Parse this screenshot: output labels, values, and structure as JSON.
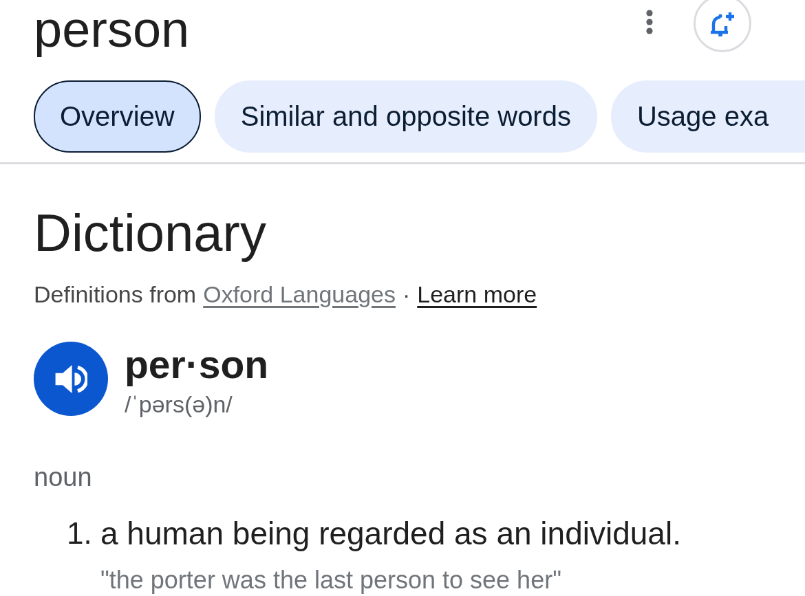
{
  "header": {
    "title": "person"
  },
  "tabs": [
    {
      "label": "Overview",
      "selected": true
    },
    {
      "label": "Similar and opposite words",
      "selected": false
    },
    {
      "label": "Usage exa",
      "selected": false
    }
  ],
  "dictionary": {
    "heading": "Dictionary",
    "source": {
      "prefix": "Definitions from",
      "provider_link": "Oxford Languages",
      "separator": "·",
      "learn_more_link": "Learn more"
    },
    "entry": {
      "headword": "per·son",
      "phonetic": "/ˈpərs(ə)n/"
    },
    "senses": [
      {
        "part_of_speech": "noun",
        "definitions": [
          {
            "number": "1.",
            "text": "a human being regarded as an individual.",
            "example": "\"the porter was the last person to see her\""
          }
        ]
      }
    ]
  }
}
